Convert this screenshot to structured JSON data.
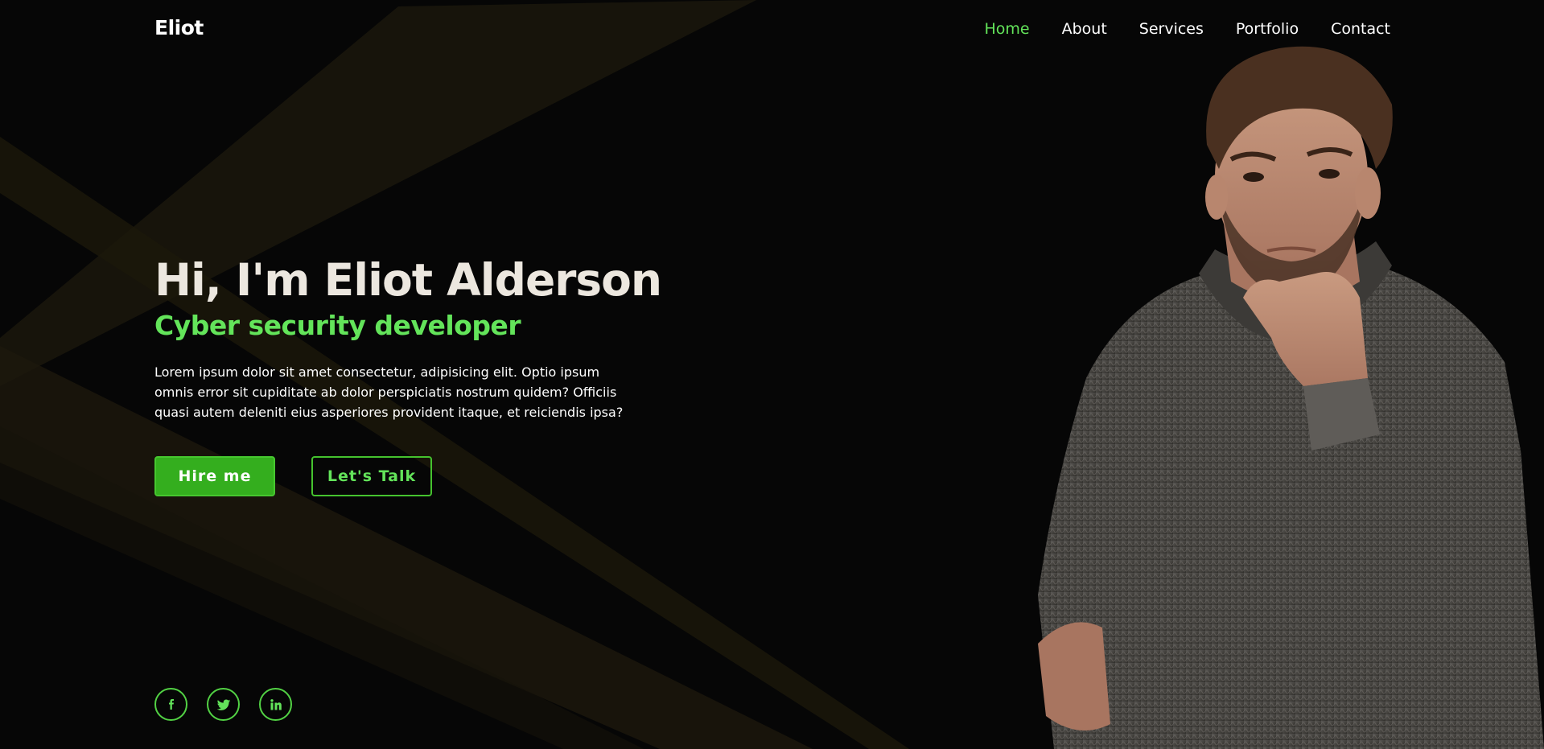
{
  "header": {
    "logo": "Eliot",
    "nav": [
      {
        "label": "Home",
        "active": true
      },
      {
        "label": "About",
        "active": false
      },
      {
        "label": "Services",
        "active": false
      },
      {
        "label": "Portfolio",
        "active": false
      },
      {
        "label": "Contact",
        "active": false
      }
    ]
  },
  "hero": {
    "greeting": "Hi, I'm Eliot Alderson",
    "role": "Cyber security developer",
    "description": "Lorem ipsum dolor sit amet consectetur, adipisicing elit. Optio ipsum omnis error sit cupiditate ab dolor perspiciatis nostrum quidem? Officiis quasi autem deleniti eius asperiores provident itaque, et reiciendis ipsa?",
    "primary_button": "Hire me",
    "secondary_button": "Let's Talk"
  },
  "social": [
    {
      "icon": "facebook-icon"
    },
    {
      "icon": "twitter-icon"
    },
    {
      "icon": "linkedin-icon"
    }
  ],
  "colors": {
    "background": "#060606",
    "accent": "#63e45a",
    "button_fill": "#34ae1e",
    "heading": "#ece7df",
    "beam": "#2a2312"
  }
}
